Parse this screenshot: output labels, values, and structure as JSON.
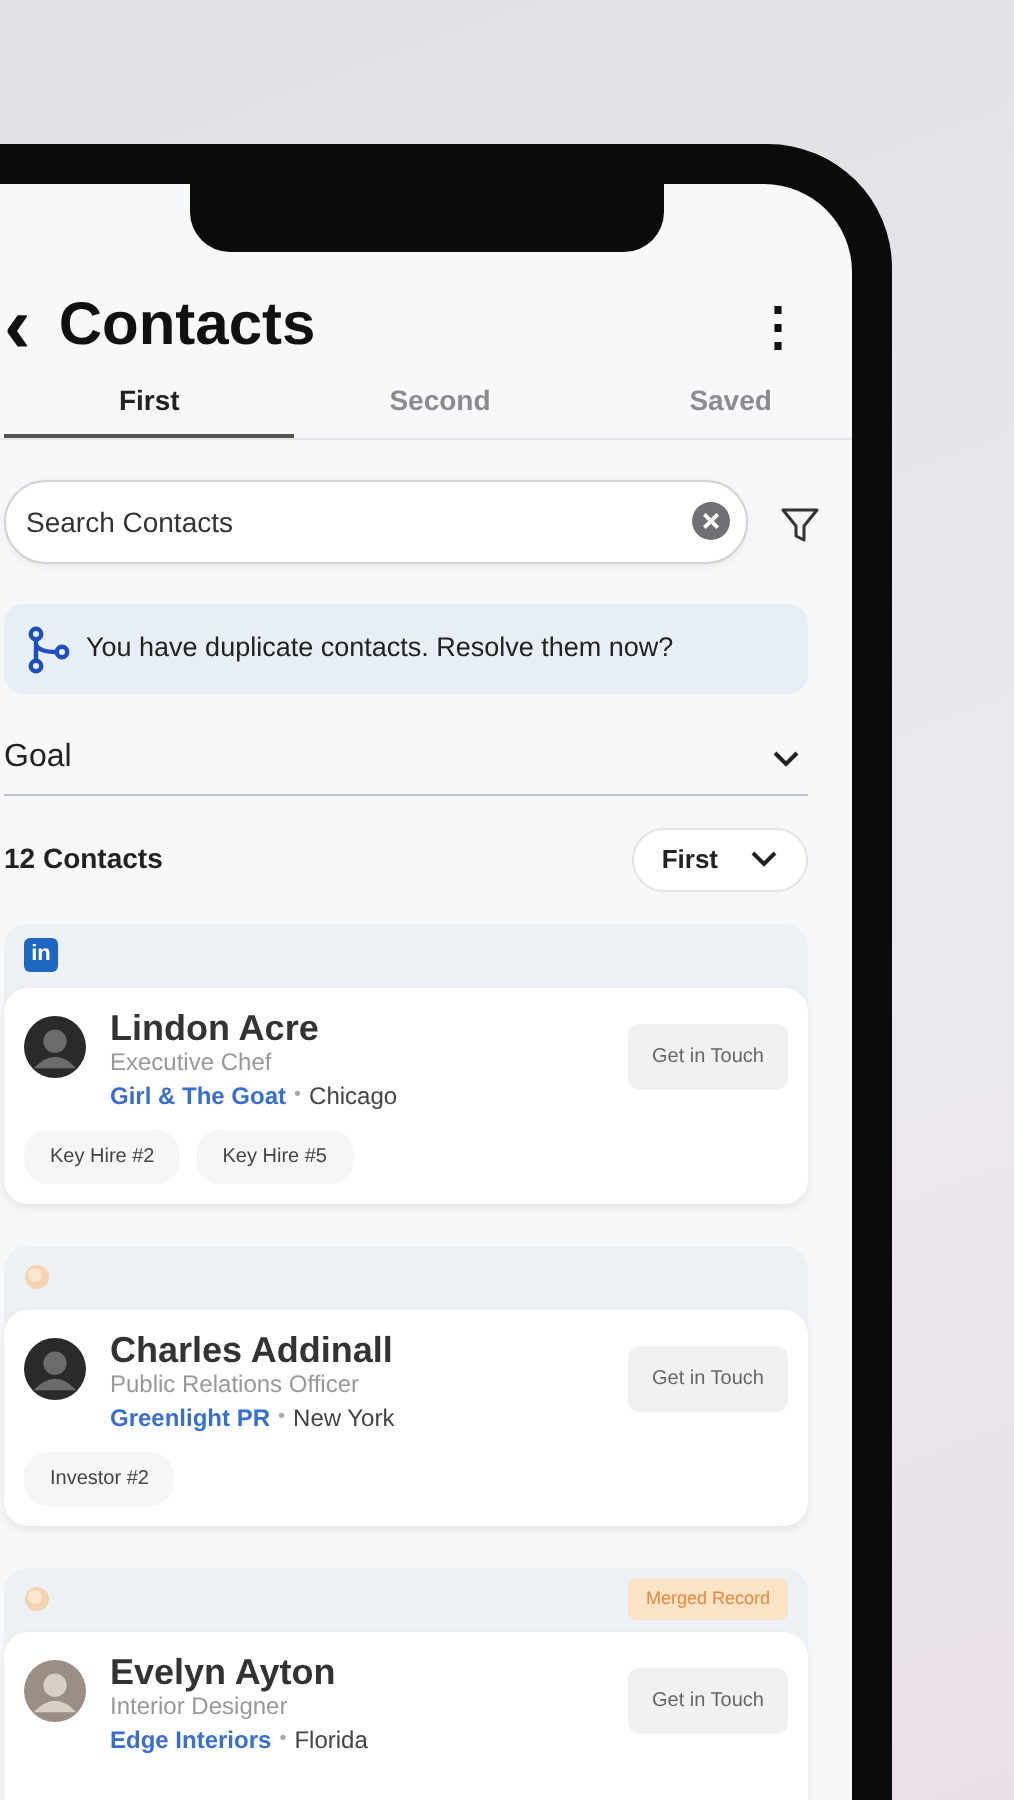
{
  "header": {
    "back": "‹",
    "title": "Contacts",
    "menu": "⋮"
  },
  "tabs": [
    {
      "label": "First",
      "selected": true
    },
    {
      "label": "Second",
      "selected": false
    },
    {
      "label": "Saved",
      "selected": false
    }
  ],
  "search": {
    "placeholder": "Search Contacts"
  },
  "banner": {
    "text": "You have duplicate contacts.",
    "link": "Resolve them now?"
  },
  "goal": {
    "label": "Goal"
  },
  "list": {
    "count": "12 Contacts",
    "sort": "First"
  },
  "contacts": [
    {
      "kind": "linkedin",
      "source_label": "in",
      "name": "Lindon Acre",
      "role": "Executive Chef",
      "company": "Girl & The Goat",
      "separator": "•",
      "location": "Chicago",
      "action": "Get in Touch",
      "tags": [
        "Key Hire #2",
        "Key Hire #5"
      ]
    },
    {
      "kind": "dot",
      "name": "Charles Addinall",
      "role": "Public Relations Officer",
      "company": "Greenlight PR",
      "separator": "•",
      "location": "New York",
      "action": "Get in Touch",
      "tags": [
        "Investor #2"
      ]
    },
    {
      "kind": "dot",
      "badge": "Merged Record",
      "name": "Evelyn Ayton",
      "role": "Interior Designer",
      "company": "Edge Interiors",
      "separator": "•",
      "location": "Florida",
      "action": "Get in Touch"
    }
  ]
}
